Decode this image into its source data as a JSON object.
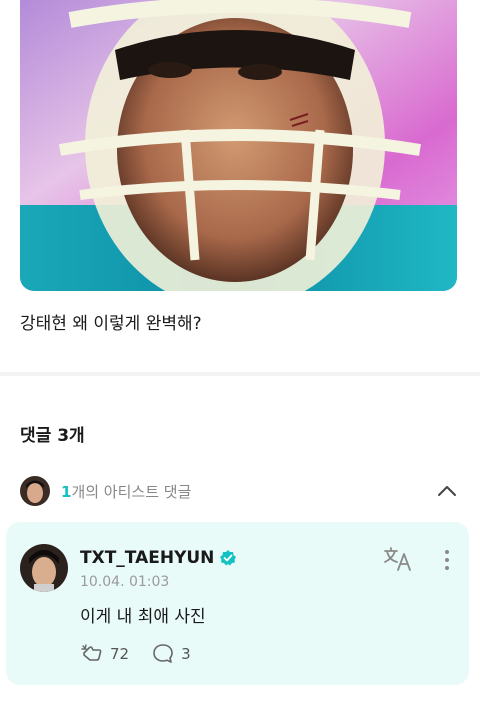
{
  "post": {
    "image_icon": "helmet-portrait-photo",
    "text": "강태현 왜 이렇게 완벽해?"
  },
  "comments": {
    "title": "댓글 3개",
    "artist_summary": {
      "count": "1",
      "label": "개의 아티스트 댓글",
      "collapse_icon": "chevron-up-icon"
    },
    "items": [
      {
        "author": "TXT_TAEHYUN",
        "verified_icon": "verified-badge-icon",
        "timestamp": "10.04. 01:03",
        "body": "이게 내 최애 사진",
        "likes": "72",
        "replies": "3"
      }
    ]
  },
  "colors": {
    "accent": "#12c2c2",
    "card_bg": "#e9fbf9"
  }
}
